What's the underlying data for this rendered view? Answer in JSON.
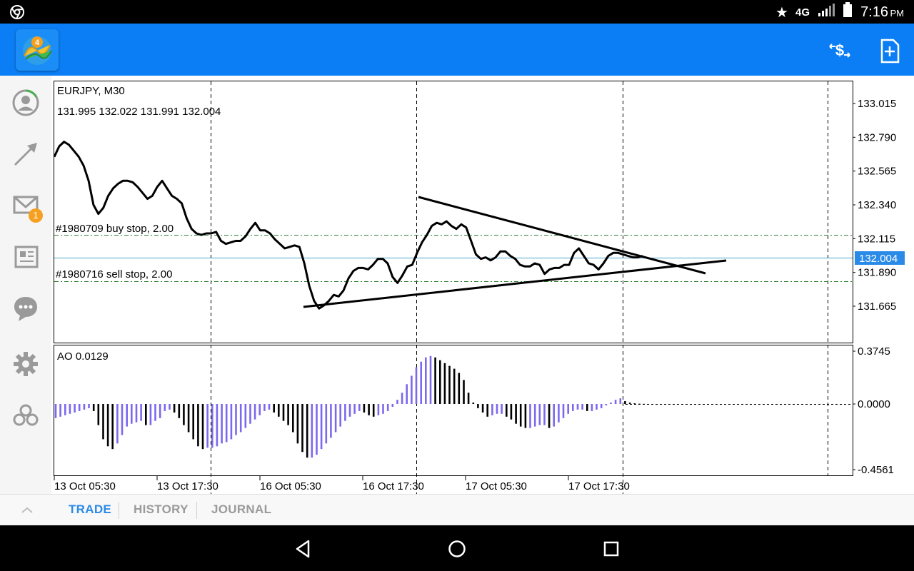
{
  "status_bar": {
    "time": "7:16",
    "ampm": "PM",
    "network": "4G"
  },
  "sidebar": {
    "mail_badge": "1",
    "items": [
      "account-icon",
      "trade-arrows-icon",
      "mail-icon",
      "news-icon",
      "chat-icon",
      "settings-icon",
      "community-icon"
    ]
  },
  "chart": {
    "symbol_label": "EURJPY, M30",
    "ohlc_label": "131.995 132.022 131.991 132.004",
    "buy_stop_label": "#1980709 buy stop, 2.00",
    "sell_stop_label": "#1980716 sell stop, 2.00",
    "current_price": "132.004",
    "price_ticks": [
      "133.015",
      "132.790",
      "132.565",
      "132.340",
      "132.115",
      "131.890",
      "131.665"
    ],
    "ao_label": "AO 0.0129",
    "ao_ticks": [
      "0.3745",
      "0.0000",
      "-0.4561"
    ],
    "time_ticks": [
      "13 Oct 05:30",
      "13 Oct 17:30",
      "16 Oct 05:30",
      "16 Oct 17:30",
      "17 Oct 05:30",
      "17 Oct 17:30"
    ],
    "colors": {
      "line": "#000000",
      "grid": "#000000",
      "current_line": "#4aa3c8",
      "order_line": "#2e7d32",
      "ao_up": "#7b68ee",
      "ao_down": "#000000",
      "price_tag": "#2a8ae8"
    }
  },
  "chart_data": {
    "type": "line",
    "title": "EURJPY, M30",
    "series": [
      {
        "values": [
          132.66,
          132.73,
          132.76,
          132.74,
          132.7,
          132.66,
          132.6,
          132.5,
          132.34,
          132.28,
          132.32,
          132.4,
          132.45,
          132.48,
          132.5,
          132.5,
          132.49,
          132.46,
          132.42,
          132.38,
          132.4,
          132.46,
          132.5,
          132.45,
          132.4,
          132.38,
          132.35,
          132.25,
          132.18,
          132.15,
          132.14,
          132.15,
          132.15,
          132.16,
          132.1,
          132.08,
          132.09,
          132.1,
          132.1,
          132.13,
          132.18,
          132.22,
          132.17,
          132.17,
          132.15,
          132.11,
          132.08,
          132.05,
          132.06,
          132.07,
          132.06,
          131.95,
          131.8,
          131.7,
          131.65,
          131.67,
          131.7,
          131.74,
          131.73,
          131.77,
          131.85,
          131.9,
          131.92,
          131.92,
          131.91,
          131.94,
          131.98,
          131.98,
          131.95,
          131.86,
          131.82,
          131.87,
          131.93,
          131.94,
          132.02,
          132.09,
          132.14,
          132.2,
          132.22,
          132.21,
          132.23,
          132.2,
          132.18,
          132.21,
          132.19,
          132.1,
          132.01,
          131.98,
          131.99,
          131.97,
          131.99,
          132.03,
          132.03,
          132.0,
          131.98,
          131.94,
          131.93,
          131.93,
          131.95,
          131.94,
          131.88,
          131.91,
          131.92,
          131.92,
          131.94,
          131.94,
          132.02,
          132.05,
          132.0,
          131.95,
          131.94,
          131.91,
          131.95,
          132.0,
          132.02,
          132.02,
          132.01,
          132.0,
          131.99,
          131.99,
          132.0
        ]
      }
    ],
    "x_ticks": [
      "13 Oct 05:30",
      "13 Oct 17:30",
      "16 Oct 05:30",
      "16 Oct 17:30",
      "17 Oct 05:30",
      "17 Oct 17:30"
    ],
    "ylim": [
      131.55,
      133.1
    ],
    "grid": true,
    "indicator": {
      "name": "AO 0.0129",
      "ylim": [
        -0.4561,
        0.3745
      ],
      "values": [
        -0.1,
        -0.09,
        -0.08,
        -0.07,
        -0.06,
        -0.05,
        -0.04,
        -0.03,
        -0.05,
        -0.15,
        -0.25,
        -0.3,
        -0.32,
        -0.28,
        -0.22,
        -0.16,
        -0.14,
        -0.13,
        -0.12,
        -0.15,
        -0.15,
        -0.12,
        -0.1,
        -0.05,
        -0.04,
        -0.06,
        -0.1,
        -0.15,
        -0.2,
        -0.25,
        -0.3,
        -0.32,
        -0.31,
        -0.31,
        -0.3,
        -0.28,
        -0.27,
        -0.25,
        -0.22,
        -0.2,
        -0.17,
        -0.14,
        -0.11,
        -0.08,
        -0.05,
        -0.04,
        -0.06,
        -0.09,
        -0.12,
        -0.15,
        -0.2,
        -0.28,
        -0.34,
        -0.38,
        -0.38,
        -0.36,
        -0.32,
        -0.28,
        -0.24,
        -0.2,
        -0.16,
        -0.12,
        -0.09,
        -0.07,
        -0.05,
        -0.06,
        -0.08,
        -0.09,
        -0.08,
        -0.07,
        -0.05,
        -0.02,
        0.03,
        0.08,
        0.14,
        0.2,
        0.26,
        0.3,
        0.33,
        0.34,
        0.33,
        0.31,
        0.29,
        0.27,
        0.25,
        0.22,
        0.17,
        0.08,
        0.01,
        -0.03,
        -0.06,
        -0.09,
        -0.08,
        -0.07,
        -0.07,
        -0.09,
        -0.11,
        -0.14,
        -0.16,
        -0.17,
        -0.17,
        -0.16,
        -0.15,
        -0.15,
        -0.17,
        -0.16,
        -0.13,
        -0.1,
        -0.07,
        -0.05,
        -0.04,
        -0.04,
        -0.05,
        -0.05,
        -0.04,
        -0.03,
        -0.01,
        0.01,
        0.03,
        0.04,
        0.02,
        0.01,
        0.005,
        0.002,
        0.001
      ]
    }
  }
}
